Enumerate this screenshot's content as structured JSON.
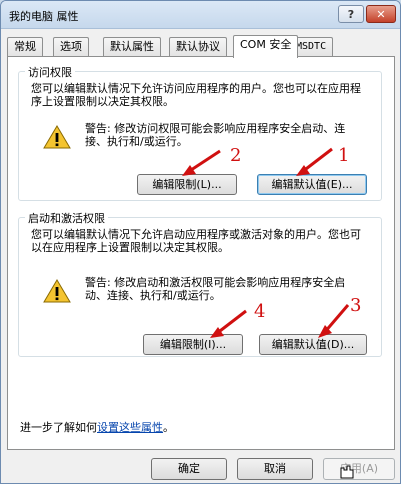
{
  "window": {
    "title": "我的电脑 属性",
    "help_label": "?",
    "close_label": "✕"
  },
  "tabs": [
    {
      "label": "常规"
    },
    {
      "label": "选项"
    },
    {
      "label": "默认属性"
    },
    {
      "label": "默认协议"
    },
    {
      "label": "COM 安全"
    },
    {
      "label": "MSDTC"
    }
  ],
  "access_group": {
    "title": "访问权限",
    "description": "您可以编辑默认情况下允许访问应用程序的用户。您也可以在应用程序上设置限制以决定其权限。",
    "warning": "警告: 修改访问权限可能会影响应用程序安全启动、连接、执行和/或运行。",
    "edit_limits_label": "编辑限制(L)...",
    "edit_default_label": "编辑默认值(E)..."
  },
  "launch_group": {
    "title": "启动和激活权限",
    "description": "您可以编辑默认情况下允许启动应用程序或激活对象的用户。您也可以在应用程序上设置限制以决定其权限。",
    "warning": "警告: 修改启动和激活权限可能会影响应用程序安全启动、连接、执行和/或运行。",
    "edit_limits_label": "编辑限制(I)...",
    "edit_default_label": "编辑默认值(D)..."
  },
  "annotations": [
    "2",
    "1",
    "4",
    "3"
  ],
  "footer": {
    "prefix": "进一步了解如何",
    "link": "设置这些属性",
    "suffix": "。"
  },
  "dialog_buttons": {
    "ok": "确定",
    "cancel": "取消",
    "apply": "应用(A)"
  },
  "colors": {
    "annotation_red": "#d01010",
    "link_blue": "#0645ad"
  }
}
